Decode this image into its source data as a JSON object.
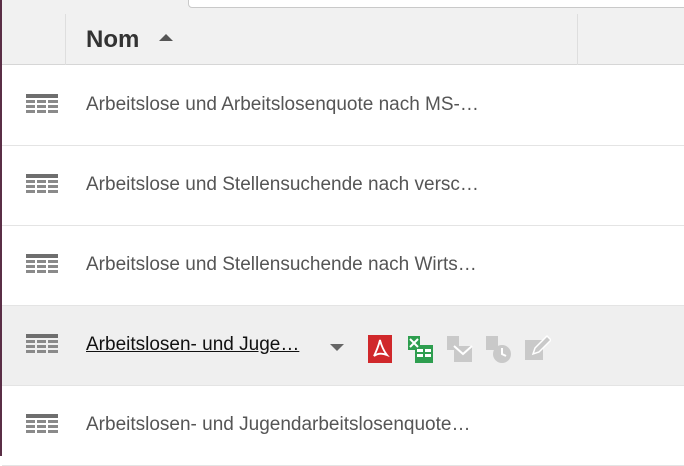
{
  "header": {
    "title": "Nom"
  },
  "rows": [
    {
      "label": "Arbeitslose und Arbeitslosenquote nach MS-…"
    },
    {
      "label": "Arbeitslose und Stellensuchende nach versc…"
    },
    {
      "label": "Arbeitslose und Stellensuchende nach Wirts…"
    },
    {
      "label": "Arbeitslosen- und Juge…"
    },
    {
      "label": "Arbeitslosen- und Jugendarbeitslosenquote…"
    }
  ],
  "actions": [
    "pdf-icon",
    "excel-icon",
    "email-icon",
    "schedule-icon",
    "edit-icon"
  ],
  "colors": {
    "pdf": "#d0282b",
    "excel": "#2e9e4f",
    "disabled": "#c9c9c9",
    "icon": "#666666"
  }
}
